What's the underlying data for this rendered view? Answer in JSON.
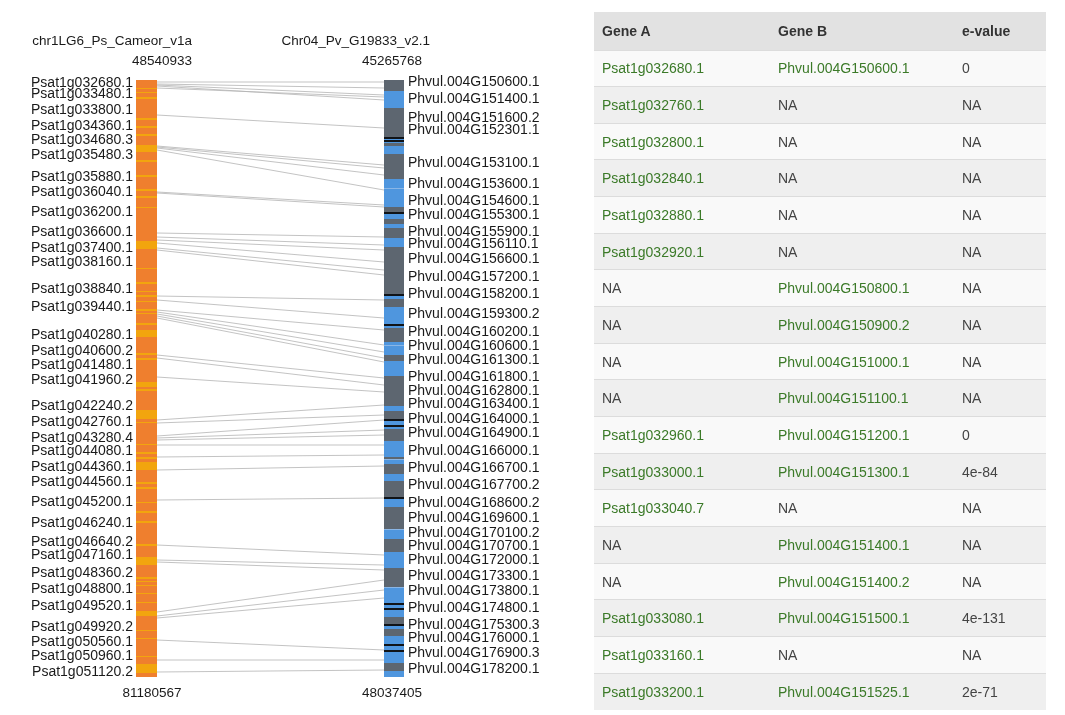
{
  "synteny": {
    "genome_a": {
      "name": "chr1LG6_Ps_Cameor_v1a",
      "start": "48540933",
      "end": "81180567",
      "genes": [
        "Psat1g032680.1",
        "Psat1g033480.1",
        "Psat1g033800.1",
        "Psat1g034360.1",
        "Psat1g034680.3",
        "Psat1g035480.3",
        "Psat1g035880.1",
        "Psat1g036040.1",
        "Psat1g036200.1",
        "Psat1g036600.1",
        "Psat1g037400.1",
        "Psat1g038160.1",
        "Psat1g038840.1",
        "Psat1g039440.1",
        "Psat1g040280.1",
        "Psat1g040600.2",
        "Psat1g041480.1",
        "Psat1g041960.2",
        "Psat1g042240.2",
        "Psat1g042760.1",
        "Psat1g043280.4",
        "Psat1g044080.1",
        "Psat1g044360.1",
        "Psat1g044560.1",
        "Psat1g045200.1",
        "Psat1g046240.1",
        "Psat1g046640.2",
        "Psat1g047160.1",
        "Psat1g048360.2",
        "Psat1g048800.1",
        "Psat1g049520.1",
        "Psat1g049920.2",
        "Psat1g050560.1",
        "Psat1g050960.1",
        "Psat1g051120.2"
      ]
    },
    "genome_b": {
      "name": "Chr04_Pv_G19833_v2.1",
      "start": "45265768",
      "end": "48037405",
      "genes": [
        "Phvul.004G150600.1",
        "Phvul.004G151400.1",
        "Phvul.004G151600.2",
        "Phvul.004G152301.1",
        "Phvul.004G153100.1",
        "Phvul.004G153600.1",
        "Phvul.004G154600.1",
        "Phvul.004G155300.1",
        "Phvul.004G155900.1",
        "Phvul.004G156110.1",
        "Phvul.004G156600.1",
        "Phvul.004G157200.1",
        "Phvul.004G158200.1",
        "Phvul.004G159300.2",
        "Phvul.004G160200.1",
        "Phvul.004G160600.1",
        "Phvul.004G161300.1",
        "Phvul.004G161800.1",
        "Phvul.004G162800.1",
        "Phvul.004G163400.1",
        "Phvul.004G164000.1",
        "Phvul.004G164900.1",
        "Phvul.004G166000.1",
        "Phvul.004G166700.1",
        "Phvul.004G167700.2",
        "Phvul.004G168600.2",
        "Phvul.004G169600.1",
        "Phvul.004G170100.2",
        "Phvul.004G170700.1",
        "Phvul.004G172000.1",
        "Phvul.004G173300.1",
        "Phvul.004G173800.1",
        "Phvul.004G174800.1",
        "Phvul.004G175300.3",
        "Phvul.004G176000.1",
        "Phvul.004G176900.3",
        "Phvul.004G178200.1"
      ]
    }
  },
  "table": {
    "columns": [
      "Gene A",
      "Gene B",
      "e-value"
    ],
    "rows": [
      {
        "gene_a": {
          "text": "Psat1g032680.1",
          "linked": true
        },
        "gene_b": {
          "text": "Phvul.004G150600.1",
          "linked": true
        },
        "e_value": "0"
      },
      {
        "gene_a": {
          "text": "Psat1g032760.1",
          "linked": true
        },
        "gene_b": {
          "text": "NA",
          "linked": false
        },
        "e_value": "NA"
      },
      {
        "gene_a": {
          "text": "Psat1g032800.1",
          "linked": true
        },
        "gene_b": {
          "text": "NA",
          "linked": false
        },
        "e_value": "NA"
      },
      {
        "gene_a": {
          "text": "Psat1g032840.1",
          "linked": true
        },
        "gene_b": {
          "text": "NA",
          "linked": false
        },
        "e_value": "NA"
      },
      {
        "gene_a": {
          "text": "Psat1g032880.1",
          "linked": true
        },
        "gene_b": {
          "text": "NA",
          "linked": false
        },
        "e_value": "NA"
      },
      {
        "gene_a": {
          "text": "Psat1g032920.1",
          "linked": true
        },
        "gene_b": {
          "text": "NA",
          "linked": false
        },
        "e_value": "NA"
      },
      {
        "gene_a": {
          "text": "NA",
          "linked": false
        },
        "gene_b": {
          "text": "Phvul.004G150800.1",
          "linked": true
        },
        "e_value": "NA"
      },
      {
        "gene_a": {
          "text": "NA",
          "linked": false
        },
        "gene_b": {
          "text": "Phvul.004G150900.2",
          "linked": true
        },
        "e_value": "NA"
      },
      {
        "gene_a": {
          "text": "NA",
          "linked": false
        },
        "gene_b": {
          "text": "Phvul.004G151000.1",
          "linked": true
        },
        "e_value": "NA"
      },
      {
        "gene_a": {
          "text": "NA",
          "linked": false
        },
        "gene_b": {
          "text": "Phvul.004G151100.1",
          "linked": true
        },
        "e_value": "NA"
      },
      {
        "gene_a": {
          "text": "Psat1g032960.1",
          "linked": true
        },
        "gene_b": {
          "text": "Phvul.004G151200.1",
          "linked": true
        },
        "e_value": "0"
      },
      {
        "gene_a": {
          "text": "Psat1g033000.1",
          "linked": true
        },
        "gene_b": {
          "text": "Phvul.004G151300.1",
          "linked": true
        },
        "e_value": "4e-84"
      },
      {
        "gene_a": {
          "text": "Psat1g033040.7",
          "linked": true
        },
        "gene_b": {
          "text": "NA",
          "linked": false
        },
        "e_value": "NA"
      },
      {
        "gene_a": {
          "text": "NA",
          "linked": false
        },
        "gene_b": {
          "text": "Phvul.004G151400.1",
          "linked": true
        },
        "e_value": "NA"
      },
      {
        "gene_a": {
          "text": "NA",
          "linked": false
        },
        "gene_b": {
          "text": "Phvul.004G151400.2",
          "linked": true
        },
        "e_value": "NA"
      },
      {
        "gene_a": {
          "text": "Psat1g033080.1",
          "linked": true
        },
        "gene_b": {
          "text": "Phvul.004G151500.1",
          "linked": true
        },
        "e_value": "4e-131"
      },
      {
        "gene_a": {
          "text": "Psat1g033160.1",
          "linked": true
        },
        "gene_b": {
          "text": "NA",
          "linked": false
        },
        "e_value": "NA"
      },
      {
        "gene_a": {
          "text": "Psat1g033200.1",
          "linked": true
        },
        "gene_b": {
          "text": "Phvul.004G151525.1",
          "linked": true
        },
        "e_value": "2e-71"
      }
    ]
  }
}
